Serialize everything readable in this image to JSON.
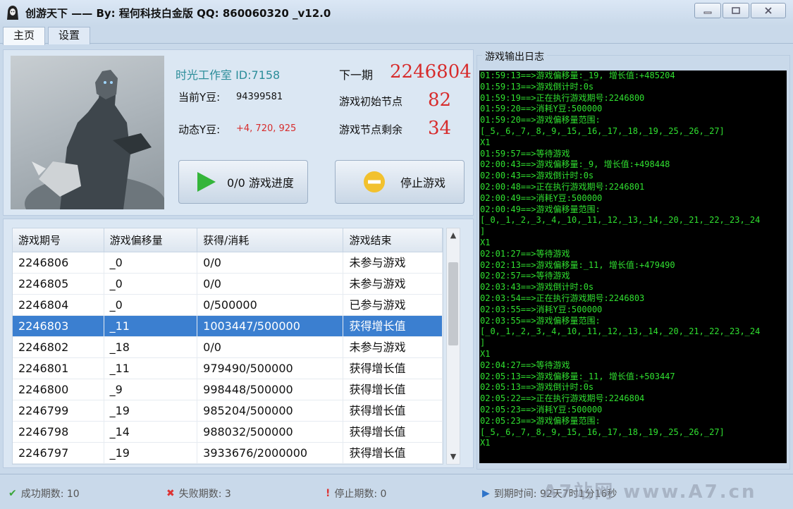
{
  "window": {
    "title": "创游天下 —— By: 程何科技白金版 QQ: 860060320 _v12.0"
  },
  "tabs": [
    {
      "label": "主页",
      "active": true
    },
    {
      "label": "设置",
      "active": false
    }
  ],
  "info": {
    "studio": "时光工作室  ID:7158",
    "current_label": "当前Y豆:",
    "current_value": "94399581",
    "dynamic_label": "动态Y豆:",
    "dynamic_value": "+4, 720, 925",
    "next_label": "下一期",
    "next_value": "2246804",
    "start_node_label": "游戏初始节点",
    "start_node_value": "82",
    "remain_node_label": "游戏节点剩余",
    "remain_node_value": "34"
  },
  "buttons": {
    "progress_label": "0/0 游戏进度",
    "stop_label": "停止游戏"
  },
  "table": {
    "headers": [
      "游戏期号",
      "游戏偏移量",
      "获得/消耗",
      "游戏结束"
    ],
    "rows": [
      [
        "2246806",
        "_0",
        "0/0",
        "未参与游戏"
      ],
      [
        "2246805",
        "_0",
        "0/0",
        "未参与游戏"
      ],
      [
        "2246804",
        "_0",
        "0/500000",
        "已参与游戏"
      ],
      [
        "2246803",
        "_11",
        "1003447/500000",
        "获得增长值"
      ],
      [
        "2246802",
        "_18",
        "0/0",
        "未参与游戏"
      ],
      [
        "2246801",
        "_11",
        "979490/500000",
        "获得增长值"
      ],
      [
        "2246800",
        "_9",
        "998448/500000",
        "获得增长值"
      ],
      [
        "2246799",
        "_19",
        "985204/500000",
        "获得增长值"
      ],
      [
        "2246798",
        "_14",
        "988032/500000",
        "获得增长值"
      ],
      [
        "2246797",
        "_19",
        "3933676/2000000",
        "获得增长值"
      ]
    ],
    "selected_row": 3
  },
  "log": {
    "title": "游戏输出日志",
    "lines": [
      "01:59:13==>游戏偏移量:_19, 增长值:+485204",
      "01:59:13==>游戏倒计时:0s",
      "01:59:19==>正在执行游戏期号:2246800",
      "01:59:20==>消耗Y豆:500000",
      "01:59:20==>游戏偏移量范围:",
      "[_5,_6,_7,_8,_9,_15,_16,_17,_18,_19,_25,_26,_27]",
      "X1",
      "01:59:57==>等待游戏",
      "02:00:43==>游戏偏移量:_9, 增长值:+498448",
      "02:00:43==>游戏倒计时:0s",
      "02:00:48==>正在执行游戏期号:2246801",
      "02:00:49==>消耗Y豆:500000",
      "02:00:49==>游戏偏移量范围:",
      "[_0,_1,_2,_3,_4,_10,_11,_12,_13,_14,_20,_21,_22,_23,_24",
      "]",
      "X1",
      "02:01:27==>等待游戏",
      "02:02:13==>游戏偏移量:_11, 增长值:+479490",
      "02:02:57==>等待游戏",
      "02:03:43==>游戏倒计时:0s",
      "02:03:54==>正在执行游戏期号:2246803",
      "02:03:55==>消耗Y豆:500000",
      "02:03:55==>游戏偏移量范围:",
      "[_0,_1,_2,_3,_4,_10,_11,_12,_13,_14,_20,_21,_22,_23,_24",
      "]",
      "X1",
      "02:04:27==>等待游戏",
      "02:05:13==>游戏偏移量:_11, 增长值:+503447",
      "02:05:13==>游戏倒计时:0s",
      "02:05:22==>正在执行游戏期号:2246804",
      "02:05:23==>消耗Y豆:500000",
      "02:05:23==>游戏偏移量范围:",
      "[_5,_6,_7,_8,_9,_15,_16,_17,_18,_19,_25,_26,_27]",
      "X1"
    ]
  },
  "status": {
    "success": "成功期数: 10",
    "fail": "失败期数: 3",
    "stop": "停止期数: 0",
    "expire": "到期时间: 92天7时1分16秒"
  },
  "watermark": "A7站网 www.A7.cn",
  "colors": {
    "accent_red": "#d72c2c",
    "log_green": "#30e030",
    "selection_blue": "#3b7fd0",
    "studio_teal": "#2c8d9a"
  }
}
